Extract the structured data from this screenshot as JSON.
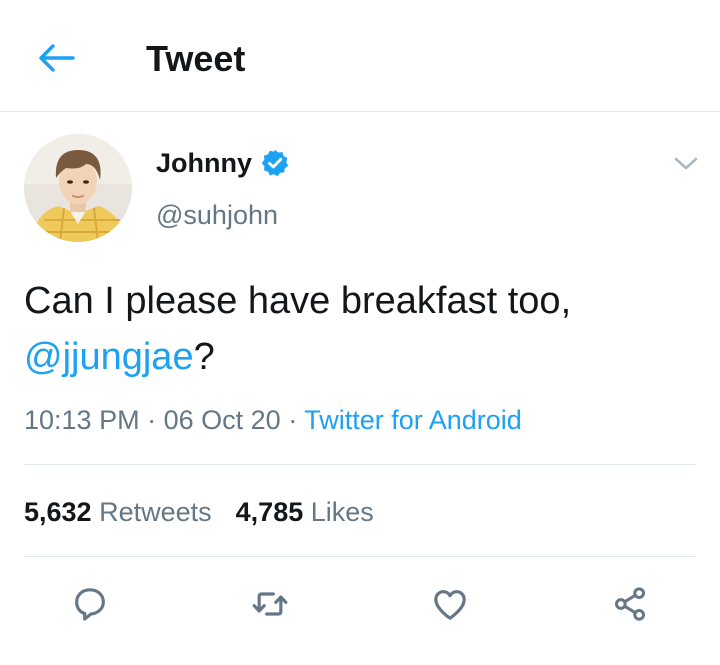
{
  "header": {
    "title": "Tweet",
    "back_icon": "arrow-left-icon"
  },
  "tweet": {
    "author": {
      "name": "Johnny",
      "handle": "@suhjohn",
      "verified": true
    },
    "text_before": "Can I please have breakfast too,",
    "mention": "@jjungjae",
    "text_after": "?",
    "time": "10:13 PM",
    "date": "06 Oct 20",
    "separator": "·",
    "source": "Twitter for Android",
    "retweets": {
      "count": "5,632",
      "label": "Retweets"
    },
    "likes": {
      "count": "4,785",
      "label": "Likes"
    }
  },
  "actions": [
    "reply-icon",
    "retweet-icon",
    "like-icon",
    "share-icon"
  ],
  "colors": {
    "accent": "#1da1f2",
    "text": "#14171a",
    "secondary": "#657786",
    "divider": "#e1e8ed"
  }
}
